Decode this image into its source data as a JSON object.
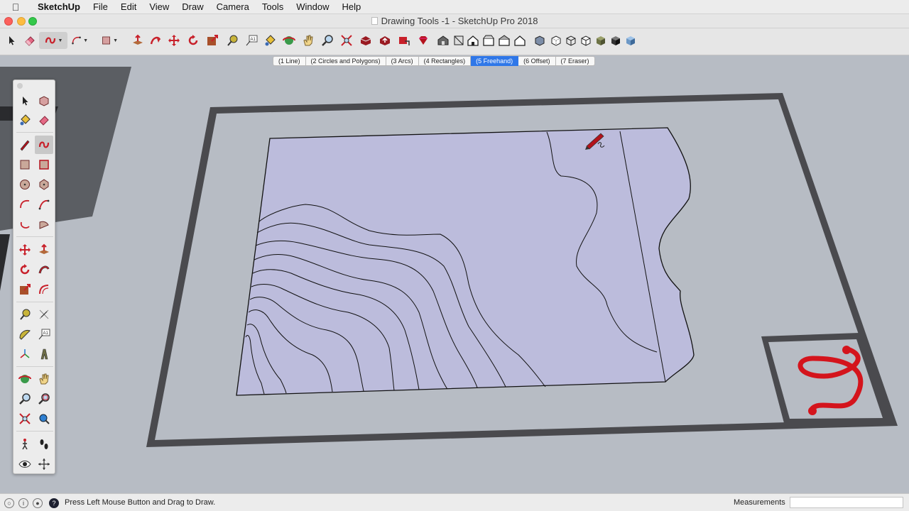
{
  "menubar": {
    "app": "SketchUp",
    "items": [
      "File",
      "Edit",
      "View",
      "Draw",
      "Camera",
      "Tools",
      "Window",
      "Help"
    ]
  },
  "window": {
    "title": "Drawing Tools -1 - SketchUp Pro 2018"
  },
  "scene_tabs": [
    {
      "label": "(1 Line)",
      "active": false
    },
    {
      "label": "(2 Circles and Polygons)",
      "active": false
    },
    {
      "label": "(3 Arcs)",
      "active": false
    },
    {
      "label": "(4 Rectangles)",
      "active": false
    },
    {
      "label": "(5 Freehand)",
      "active": true
    },
    {
      "label": "(6 Offset)",
      "active": false
    },
    {
      "label": "(7 Eraser)",
      "active": false
    }
  ],
  "status": {
    "hint": "Press Left Mouse Button and Drag to Draw.",
    "measurements_label": "Measurements",
    "measurements_value": ""
  },
  "colors": {
    "accent": "#2f77e8",
    "face": "#bcbcdc",
    "frame": "#4a4a4e",
    "squiggle": "#d4141c",
    "ground": "#b7bcc4"
  }
}
